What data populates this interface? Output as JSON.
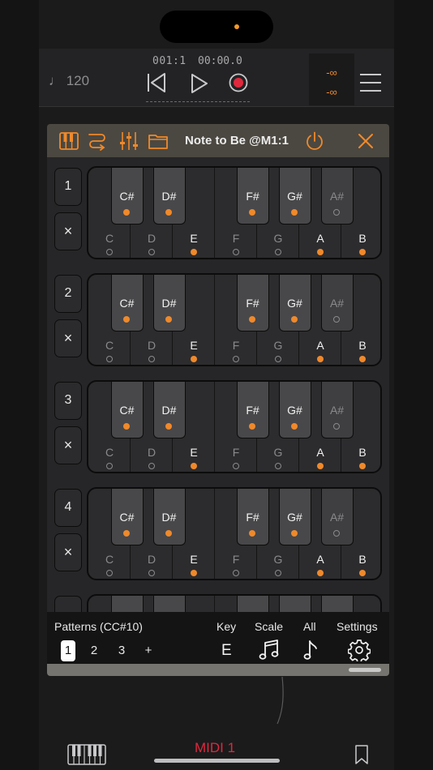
{
  "status_bar": {
    "recording_indicator_color": "#f19a2a"
  },
  "host": {
    "tempo": "♩ 120",
    "bar_position": "001:1",
    "time_position": "00:00.0",
    "meter_left": "-∞",
    "meter_right": "-∞",
    "buttons": {
      "rewind": "rewind-icon",
      "play": "play-icon",
      "record": "record-icon",
      "menu": "hamburger-menu-icon"
    },
    "track_name": "MIDI 1",
    "track_color": "#e0283c"
  },
  "plugin": {
    "title": "Note to Be @M1:1",
    "accent": "#f0892a",
    "header_icons": [
      "piano-icon",
      "routing-icon",
      "mixer-sliders-icon",
      "folder-icon",
      "power-icon",
      "close-icon"
    ],
    "delete_label": "×",
    "white_keys": [
      "C",
      "D",
      "E",
      "F",
      "G",
      "A",
      "B"
    ],
    "black_keys": [
      "C#",
      "D#",
      "F#",
      "G#",
      "A#"
    ],
    "patterns": [
      {
        "number": "1",
        "white_on": [
          false,
          false,
          true,
          false,
          false,
          true,
          true
        ],
        "black_on": [
          true,
          true,
          true,
          true,
          false
        ]
      },
      {
        "number": "2",
        "white_on": [
          false,
          false,
          true,
          false,
          false,
          true,
          true
        ],
        "black_on": [
          true,
          true,
          true,
          true,
          false
        ]
      },
      {
        "number": "3",
        "white_on": [
          false,
          false,
          true,
          false,
          false,
          true,
          true
        ],
        "black_on": [
          true,
          true,
          true,
          true,
          false
        ]
      },
      {
        "number": "4",
        "white_on": [
          false,
          false,
          true,
          false,
          false,
          true,
          true
        ],
        "black_on": [
          true,
          true,
          true,
          true,
          false
        ]
      },
      {
        "number": "",
        "white_on": [],
        "black_on": []
      }
    ],
    "footer": {
      "patterns_label": "Patterns (CC#10)",
      "pattern_tabs": [
        "1",
        "2",
        "3",
        "+"
      ],
      "selected_tab": "1",
      "key_label": "Key",
      "key_value": "E",
      "scale_label": "Scale",
      "all_label": "All",
      "settings_label": "Settings"
    }
  }
}
